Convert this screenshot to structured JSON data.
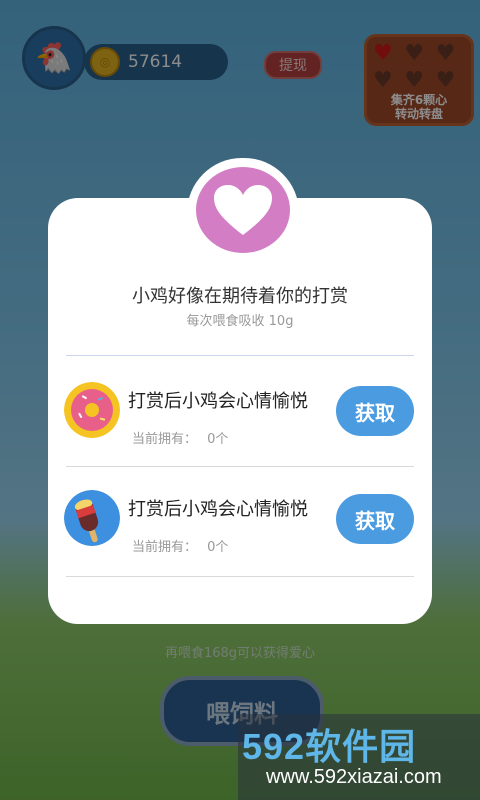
{
  "hud": {
    "coins": "57614",
    "withdraw_label": "提现",
    "hearts_caption_line1": "集齐6颗心",
    "hearts_caption_line2": "转动转盘"
  },
  "background": {
    "hint": "再喂食168g可以获得爱心",
    "feed_button": "喂饲料"
  },
  "modal": {
    "title": "小鸡好像在期待着你的打赏",
    "subtitle": "每次喂食吸收 10g",
    "items": [
      {
        "icon": "donut-icon",
        "title": "打赏后小鸡会心情愉悦",
        "owned_label": "当前拥有：",
        "owned_value": "0个",
        "button": "获取"
      },
      {
        "icon": "popsicle-icon",
        "title": "打赏后小鸡会心情愉悦",
        "owned_label": "当前拥有：",
        "owned_value": "0个",
        "button": "获取"
      }
    ]
  },
  "watermark": {
    "big": "592软件园",
    "small": "www.592xiazai.com"
  },
  "colors": {
    "modal_accent": "#d37dc5",
    "button_blue": "#4a9be0"
  }
}
